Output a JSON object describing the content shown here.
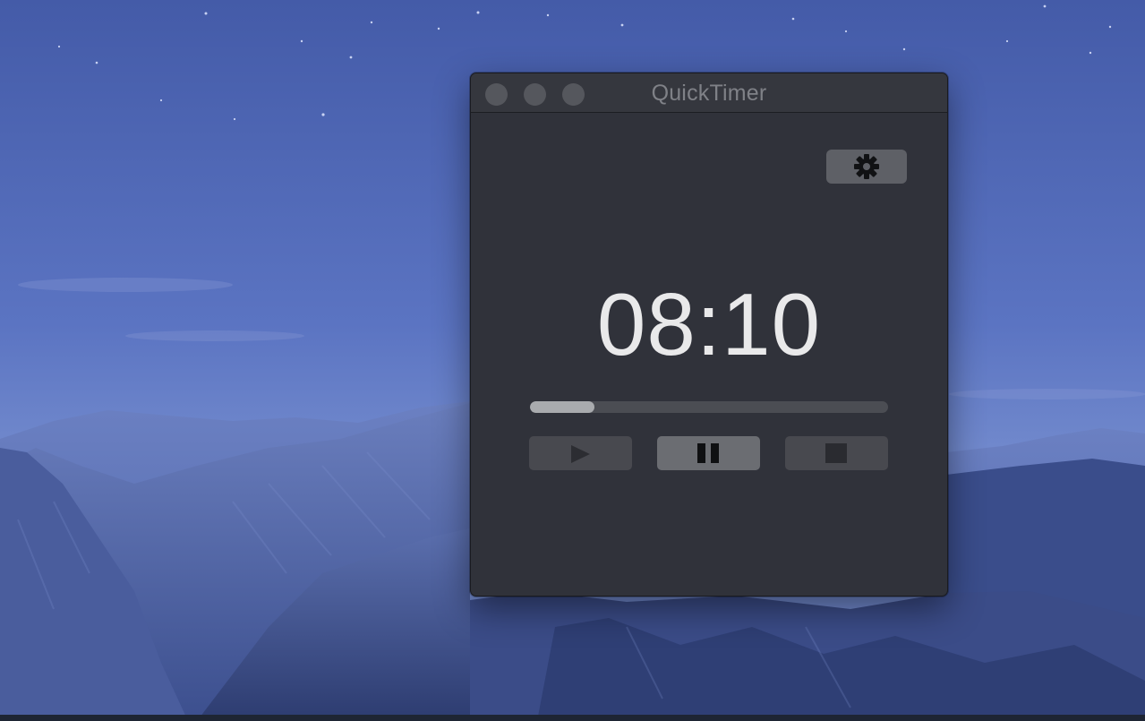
{
  "window": {
    "title": "QuickTimer"
  },
  "settings_icon": "gear-icon",
  "timer": {
    "display": "08:10",
    "progress_fraction": 0.18
  },
  "controls": [
    {
      "name": "play",
      "icon": "play-icon",
      "enabled": false
    },
    {
      "name": "pause",
      "icon": "pause-icon",
      "enabled": true
    },
    {
      "name": "stop",
      "icon": "stop-icon",
      "enabled": false
    }
  ],
  "colors": {
    "window_bg": "#30323a",
    "titlebar_bg": "#35373e",
    "time_text": "#e9e9ea",
    "progress_fill": "#a9abae",
    "progress_track": "#4b4d53",
    "button_bg": "#48494f",
    "button_active_bg": "#6b6d72"
  }
}
